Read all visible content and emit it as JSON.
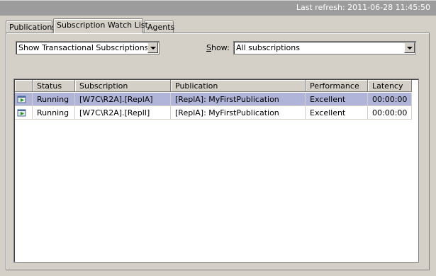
{
  "header": {
    "last_refresh": "Last refresh: 2011-06-28 11:45:50"
  },
  "tabs": [
    {
      "label": "Publications",
      "active": false
    },
    {
      "label": "Subscription Watch List",
      "active": true
    },
    {
      "label": "Agents",
      "active": false
    }
  ],
  "filter": {
    "type_value": "Show Transactional Subscriptions",
    "show_label_prefix": "S",
    "show_label_rest": "how:",
    "show_value": "All subscriptions"
  },
  "grid": {
    "columns": [
      "",
      "Status",
      "Subscription",
      "Publication",
      "Performance",
      "Latency"
    ],
    "rows": [
      {
        "status": "Running",
        "subscription": "[W7C\\R2A].[ReplA]",
        "publication": "[ReplA]: MyFirstPublication",
        "performance": "Excellent",
        "latency": "00:00:00",
        "selected": true,
        "icon": "running-agent-icon"
      },
      {
        "status": "Running",
        "subscription": "[W7C\\R2A].[ReplI]",
        "publication": "[ReplA]: MyFirstPublication",
        "performance": "Excellent",
        "latency": "00:00:00",
        "selected": false,
        "icon": "running-agent-icon"
      }
    ]
  },
  "colors": {
    "selection": "#b0b4d8",
    "window": "#d4d0c8",
    "titlebar": "#9c9c9c"
  }
}
